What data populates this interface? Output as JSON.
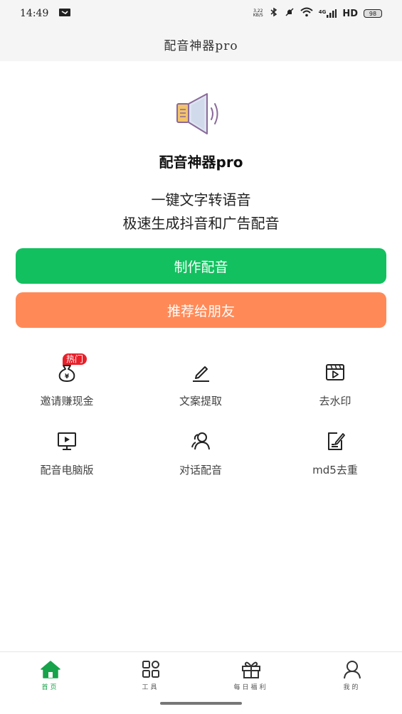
{
  "status_bar": {
    "time": "14:49",
    "net_speed_value": "3.22",
    "net_speed_unit": "KB/S",
    "signal_type": "4G",
    "hd": "HD",
    "battery": "98"
  },
  "header": {
    "title": "配音神器pro"
  },
  "app": {
    "name": "配音神器pro",
    "slogan_line1": "一键文字转语音",
    "slogan_line2": "极速生成抖音和广告配音"
  },
  "buttons": {
    "make_dubbing": "制作配音",
    "share_friends": "推荐给朋友"
  },
  "grid": [
    {
      "label": "邀请赚现金",
      "icon": "money-bag-icon",
      "badge": "热门"
    },
    {
      "label": "文案提取",
      "icon": "pen-icon"
    },
    {
      "label": "去水印",
      "icon": "video-clapper-icon"
    },
    {
      "label": "配音电脑版",
      "icon": "monitor-play-icon"
    },
    {
      "label": "对话配音",
      "icon": "users-icon"
    },
    {
      "label": "md5去重",
      "icon": "edit-doc-icon"
    }
  ],
  "tabbar": [
    {
      "label": "首页",
      "icon": "home-icon",
      "active": true
    },
    {
      "label": "工具",
      "icon": "grid-icon",
      "active": false
    },
    {
      "label": "每日福利",
      "icon": "gift-icon",
      "active": false
    },
    {
      "label": "我的",
      "icon": "user-icon",
      "active": false
    }
  ],
  "colors": {
    "primary_green": "#12c05f",
    "share_orange": "#ff8a58",
    "hot_red": "#e8202a",
    "tab_active": "#16a34a"
  }
}
